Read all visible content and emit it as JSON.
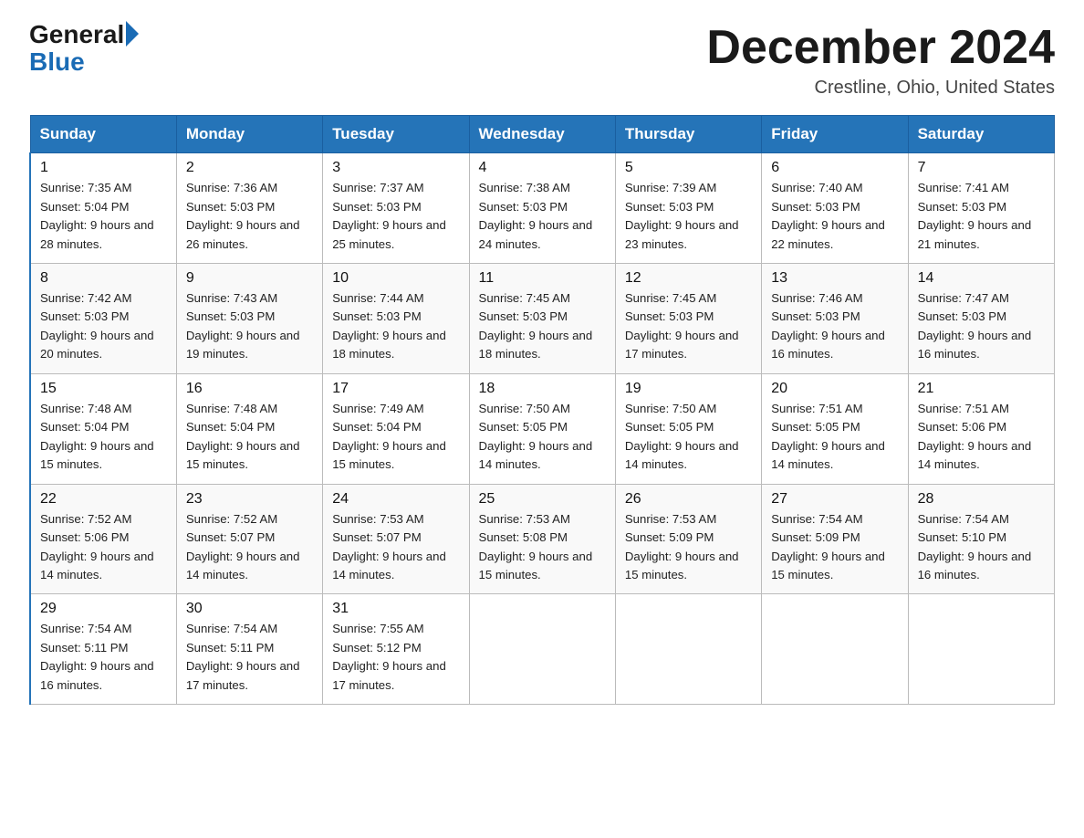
{
  "logo": {
    "general": "General",
    "blue": "Blue"
  },
  "title": "December 2024",
  "location": "Crestline, Ohio, United States",
  "days_of_week": [
    "Sunday",
    "Monday",
    "Tuesday",
    "Wednesday",
    "Thursday",
    "Friday",
    "Saturday"
  ],
  "weeks": [
    [
      {
        "day": "1",
        "sunrise": "7:35 AM",
        "sunset": "5:04 PM",
        "daylight": "9 hours and 28 minutes."
      },
      {
        "day": "2",
        "sunrise": "7:36 AM",
        "sunset": "5:03 PM",
        "daylight": "9 hours and 26 minutes."
      },
      {
        "day": "3",
        "sunrise": "7:37 AM",
        "sunset": "5:03 PM",
        "daylight": "9 hours and 25 minutes."
      },
      {
        "day": "4",
        "sunrise": "7:38 AM",
        "sunset": "5:03 PM",
        "daylight": "9 hours and 24 minutes."
      },
      {
        "day": "5",
        "sunrise": "7:39 AM",
        "sunset": "5:03 PM",
        "daylight": "9 hours and 23 minutes."
      },
      {
        "day": "6",
        "sunrise": "7:40 AM",
        "sunset": "5:03 PM",
        "daylight": "9 hours and 22 minutes."
      },
      {
        "day": "7",
        "sunrise": "7:41 AM",
        "sunset": "5:03 PM",
        "daylight": "9 hours and 21 minutes."
      }
    ],
    [
      {
        "day": "8",
        "sunrise": "7:42 AM",
        "sunset": "5:03 PM",
        "daylight": "9 hours and 20 minutes."
      },
      {
        "day": "9",
        "sunrise": "7:43 AM",
        "sunset": "5:03 PM",
        "daylight": "9 hours and 19 minutes."
      },
      {
        "day": "10",
        "sunrise": "7:44 AM",
        "sunset": "5:03 PM",
        "daylight": "9 hours and 18 minutes."
      },
      {
        "day": "11",
        "sunrise": "7:45 AM",
        "sunset": "5:03 PM",
        "daylight": "9 hours and 18 minutes."
      },
      {
        "day": "12",
        "sunrise": "7:45 AM",
        "sunset": "5:03 PM",
        "daylight": "9 hours and 17 minutes."
      },
      {
        "day": "13",
        "sunrise": "7:46 AM",
        "sunset": "5:03 PM",
        "daylight": "9 hours and 16 minutes."
      },
      {
        "day": "14",
        "sunrise": "7:47 AM",
        "sunset": "5:03 PM",
        "daylight": "9 hours and 16 minutes."
      }
    ],
    [
      {
        "day": "15",
        "sunrise": "7:48 AM",
        "sunset": "5:04 PM",
        "daylight": "9 hours and 15 minutes."
      },
      {
        "day": "16",
        "sunrise": "7:48 AM",
        "sunset": "5:04 PM",
        "daylight": "9 hours and 15 minutes."
      },
      {
        "day": "17",
        "sunrise": "7:49 AM",
        "sunset": "5:04 PM",
        "daylight": "9 hours and 15 minutes."
      },
      {
        "day": "18",
        "sunrise": "7:50 AM",
        "sunset": "5:05 PM",
        "daylight": "9 hours and 14 minutes."
      },
      {
        "day": "19",
        "sunrise": "7:50 AM",
        "sunset": "5:05 PM",
        "daylight": "9 hours and 14 minutes."
      },
      {
        "day": "20",
        "sunrise": "7:51 AM",
        "sunset": "5:05 PM",
        "daylight": "9 hours and 14 minutes."
      },
      {
        "day": "21",
        "sunrise": "7:51 AM",
        "sunset": "5:06 PM",
        "daylight": "9 hours and 14 minutes."
      }
    ],
    [
      {
        "day": "22",
        "sunrise": "7:52 AM",
        "sunset": "5:06 PM",
        "daylight": "9 hours and 14 minutes."
      },
      {
        "day": "23",
        "sunrise": "7:52 AM",
        "sunset": "5:07 PM",
        "daylight": "9 hours and 14 minutes."
      },
      {
        "day": "24",
        "sunrise": "7:53 AM",
        "sunset": "5:07 PM",
        "daylight": "9 hours and 14 minutes."
      },
      {
        "day": "25",
        "sunrise": "7:53 AM",
        "sunset": "5:08 PM",
        "daylight": "9 hours and 15 minutes."
      },
      {
        "day": "26",
        "sunrise": "7:53 AM",
        "sunset": "5:09 PM",
        "daylight": "9 hours and 15 minutes."
      },
      {
        "day": "27",
        "sunrise": "7:54 AM",
        "sunset": "5:09 PM",
        "daylight": "9 hours and 15 minutes."
      },
      {
        "day": "28",
        "sunrise": "7:54 AM",
        "sunset": "5:10 PM",
        "daylight": "9 hours and 16 minutes."
      }
    ],
    [
      {
        "day": "29",
        "sunrise": "7:54 AM",
        "sunset": "5:11 PM",
        "daylight": "9 hours and 16 minutes."
      },
      {
        "day": "30",
        "sunrise": "7:54 AM",
        "sunset": "5:11 PM",
        "daylight": "9 hours and 17 minutes."
      },
      {
        "day": "31",
        "sunrise": "7:55 AM",
        "sunset": "5:12 PM",
        "daylight": "9 hours and 17 minutes."
      },
      null,
      null,
      null,
      null
    ]
  ]
}
